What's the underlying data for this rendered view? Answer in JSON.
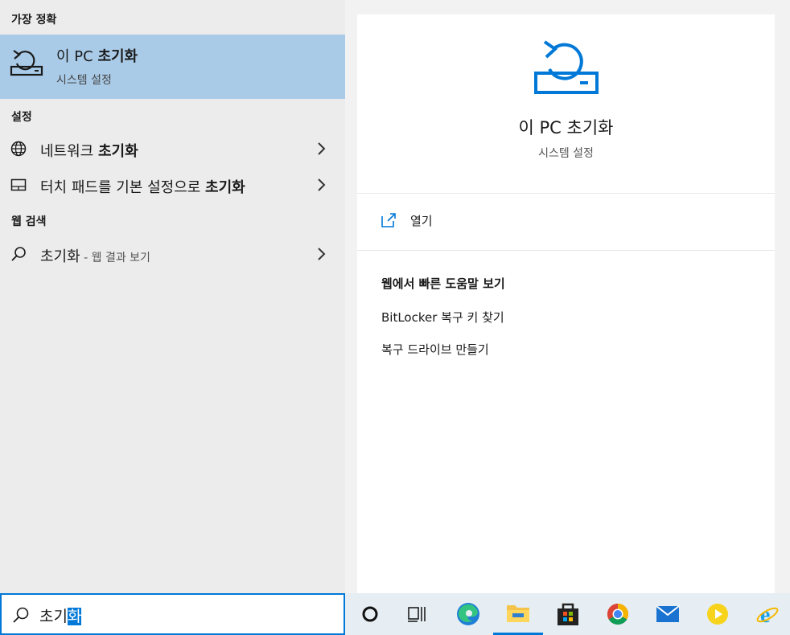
{
  "left": {
    "best_match_header": "가장 정확",
    "best_match": {
      "title_normal": "이 PC ",
      "title_bold": "초기화",
      "subtitle": "시스템 설정"
    },
    "settings_header": "설정",
    "settings_items": [
      {
        "label_normal": "네트워크 ",
        "label_bold": "초기화",
        "icon": "globe-icon"
      },
      {
        "label_normal": "터치 패드를 기본 설정으로 ",
        "label_bold": "초기화",
        "icon": "touchpad-icon"
      }
    ],
    "web_header": "웹 검색",
    "web_item": {
      "query": "초기화",
      "hint": " - 웹 결과 보기",
      "icon": "search-icon"
    }
  },
  "right": {
    "app_icon": "reset-pc-icon",
    "title": "이 PC 초기화",
    "subtitle": "시스템 설정",
    "open_label": "열기",
    "web_help_header": "웹에서 빠른 도움말 보기",
    "links": [
      "BitLocker 복구 키 찾기",
      "복구 드라이브 만들기"
    ]
  },
  "search": {
    "value_unselected": "초기",
    "value_selected": "화"
  },
  "taskbar": {
    "items": [
      "cortana-icon",
      "task-view-icon",
      "edge-icon",
      "file-explorer-icon",
      "store-icon",
      "chrome-icon",
      "mail-icon",
      "media-player-icon",
      "ie-icon"
    ]
  },
  "colors": {
    "accent": "#0078d7",
    "highlight": "#a9cbe8"
  }
}
